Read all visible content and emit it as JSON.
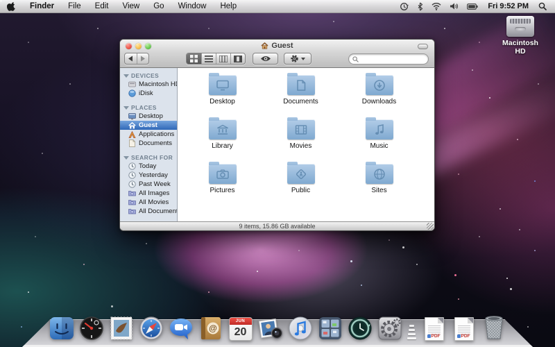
{
  "menubar": {
    "apple_icon": "apple-logo",
    "items": [
      "Finder",
      "File",
      "Edit",
      "View",
      "Go",
      "Window",
      "Help"
    ],
    "status_icons": [
      "sync-clock-icon",
      "bluetooth-icon",
      "wifi-icon",
      "volume-icon",
      "battery-icon"
    ],
    "clock": "Fri 9:52 PM",
    "spotlight_icon": "spotlight-search-icon"
  },
  "desktop": {
    "volume_icon": {
      "label": "Macintosh HD",
      "icon": "hard-drive-icon"
    }
  },
  "window": {
    "title": "Guest",
    "title_icon": "home-icon",
    "toolbar": {
      "view_modes": [
        "icon-view",
        "list-view",
        "column-view",
        "coverflow-view"
      ],
      "selected_view": "icon-view",
      "quicklook_icon": "eye-icon",
      "action_icon": "gear-icon",
      "search_value": ""
    },
    "sidebar": {
      "sections": [
        {
          "title": "DEVICES",
          "items": [
            {
              "label": "Macintosh HD",
              "icon": "hard-drive-icon"
            },
            {
              "label": "iDisk",
              "icon": "idisk-globe-icon"
            }
          ]
        },
        {
          "title": "PLACES",
          "items": [
            {
              "label": "Desktop",
              "icon": "desktop-icon"
            },
            {
              "label": "Guest",
              "icon": "home-icon",
              "selected": true
            },
            {
              "label": "Applications",
              "icon": "applications-icon"
            },
            {
              "label": "Documents",
              "icon": "document-icon"
            }
          ]
        },
        {
          "title": "SEARCH FOR",
          "items": [
            {
              "label": "Today",
              "icon": "clock-icon"
            },
            {
              "label": "Yesterday",
              "icon": "clock-icon"
            },
            {
              "label": "Past Week",
              "icon": "clock-icon"
            },
            {
              "label": "All Images",
              "icon": "smart-folder-icon"
            },
            {
              "label": "All Movies",
              "icon": "smart-folder-icon"
            },
            {
              "label": "All Documents",
              "icon": "smart-folder-icon"
            }
          ]
        }
      ]
    },
    "folders": [
      {
        "label": "Desktop",
        "glyph": "monitor"
      },
      {
        "label": "Documents",
        "glyph": "document"
      },
      {
        "label": "Downloads",
        "glyph": "download-arrow"
      },
      {
        "label": "Library",
        "glyph": "library-columns"
      },
      {
        "label": "Movies",
        "glyph": "filmstrip"
      },
      {
        "label": "Music",
        "glyph": "music-note"
      },
      {
        "label": "Pictures",
        "glyph": "camera"
      },
      {
        "label": "Public",
        "glyph": "crossing-sign"
      },
      {
        "label": "Sites",
        "glyph": "globe"
      }
    ],
    "statusbar": {
      "text": "9 items, 15.86 GB available"
    }
  },
  "dock": {
    "items": [
      "Finder",
      "Dashboard",
      "Mail",
      "Safari",
      "iChat",
      "Address Book",
      "iCal",
      "Photo Booth",
      "iTunes",
      "Spaces",
      "Time Machine",
      "System Preferences",
      "PDF Document",
      "PDF Document",
      "Trash"
    ],
    "ical_month": "JUN",
    "ical_day": "20",
    "pdf_label": "PDF"
  }
}
